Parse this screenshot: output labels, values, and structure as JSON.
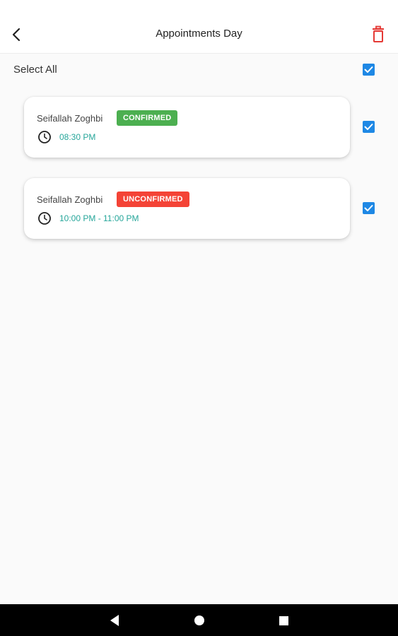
{
  "header": {
    "title": "Appointments Day",
    "back_icon": "back-arrow-icon",
    "delete_icon": "trash-icon"
  },
  "select_all": {
    "label": "Select All",
    "checked": true
  },
  "appointments": [
    {
      "name": "Seifallah Zoghbi",
      "status": "CONFIRMED",
      "status_color": "#4caf50",
      "time": "08:30 PM",
      "checked": true
    },
    {
      "name": "Seifallah Zoghbi",
      "status": "UNCONFIRMED",
      "status_color": "#f44336",
      "time": "10:00 PM - 11:00 PM",
      "checked": true
    }
  ],
  "colors": {
    "accent": "#1e88e5",
    "time_text": "#26a69a",
    "delete_icon": "#e53935"
  },
  "nav": {
    "back_icon": "triangle-back-icon",
    "home_icon": "circle-home-icon",
    "recents_icon": "square-recents-icon"
  }
}
